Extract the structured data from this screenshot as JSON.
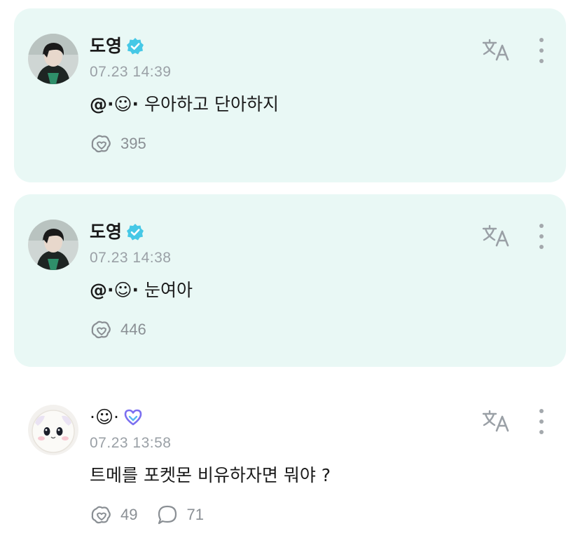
{
  "colors": {
    "highlight_bg": "#e9f8f5",
    "verified_badge": "#46c8e6",
    "fanlight_icon": "#7b6ff0",
    "muted_text": "#9aa0a6"
  },
  "posts": [
    {
      "author": "도영",
      "badge_icon": "verified-badge-icon",
      "timestamp": "07.23 14:39",
      "mention": "@·☺·",
      "text": "우아하고 단아하지",
      "like_count": "395",
      "highlighted": true
    },
    {
      "author": "도영",
      "badge_icon": "verified-badge-icon",
      "timestamp": "07.23 14:38",
      "mention": "@·☺·",
      "text": "눈여아",
      "like_count": "446",
      "highlighted": true
    },
    {
      "author": "·☺·",
      "badge_icon": "fanlight-heart-icon",
      "timestamp": "07.23 13:58",
      "text": "트메를 포켓몬 비유하자면 뭐야 ?",
      "like_count": "49",
      "comment_count": "71",
      "highlighted": false
    }
  ],
  "icons": {
    "translate": "translate-icon",
    "more": "more-vertical-icon",
    "like": "like-icon",
    "comment": "comment-icon"
  }
}
